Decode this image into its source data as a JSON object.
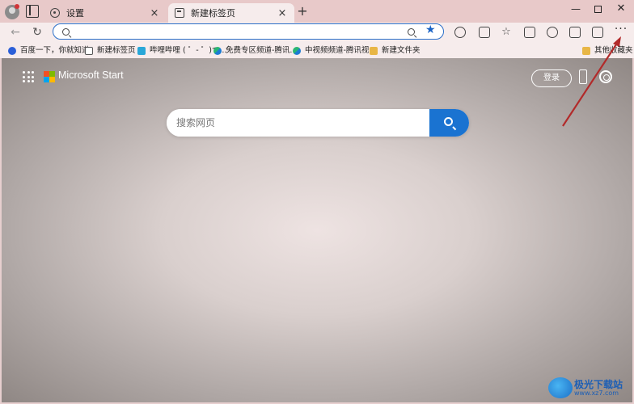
{
  "tabs": [
    {
      "label": "设置",
      "icon": "gear-icon",
      "active": false
    },
    {
      "label": "新建标签页",
      "icon": "page-icon",
      "active": true
    }
  ],
  "toolbar": {
    "address_placeholder": ""
  },
  "bookmarks": [
    {
      "label": "百度一下，你就知道",
      "icon": "baidu-paw-icon"
    },
    {
      "label": "新建标签页",
      "icon": "page-icon"
    },
    {
      "label": "哔哩哔哩 ( ゜- ゜)つ...",
      "icon": "bilibili-tv-icon"
    },
    {
      "label": "免费专区频道-腾讯...",
      "icon": "tencent-video-icon"
    },
    {
      "label": "中视频频道-腾讯视...",
      "icon": "tencent-video-icon"
    },
    {
      "label": "新建文件夹",
      "icon": "folder-icon"
    },
    {
      "label": "其他收藏夹",
      "icon": "folder-icon"
    }
  ],
  "start_page": {
    "brand": "Microsoft Start",
    "signin_label": "登录",
    "search_placeholder": "搜索网页"
  },
  "watermark": {
    "title": "极光下载站",
    "subtitle": "www.xz7.com"
  },
  "colors": {
    "accent": "#1a73d1",
    "tab_bar": "#e8c9c9",
    "arrow": "#b22a2a"
  }
}
